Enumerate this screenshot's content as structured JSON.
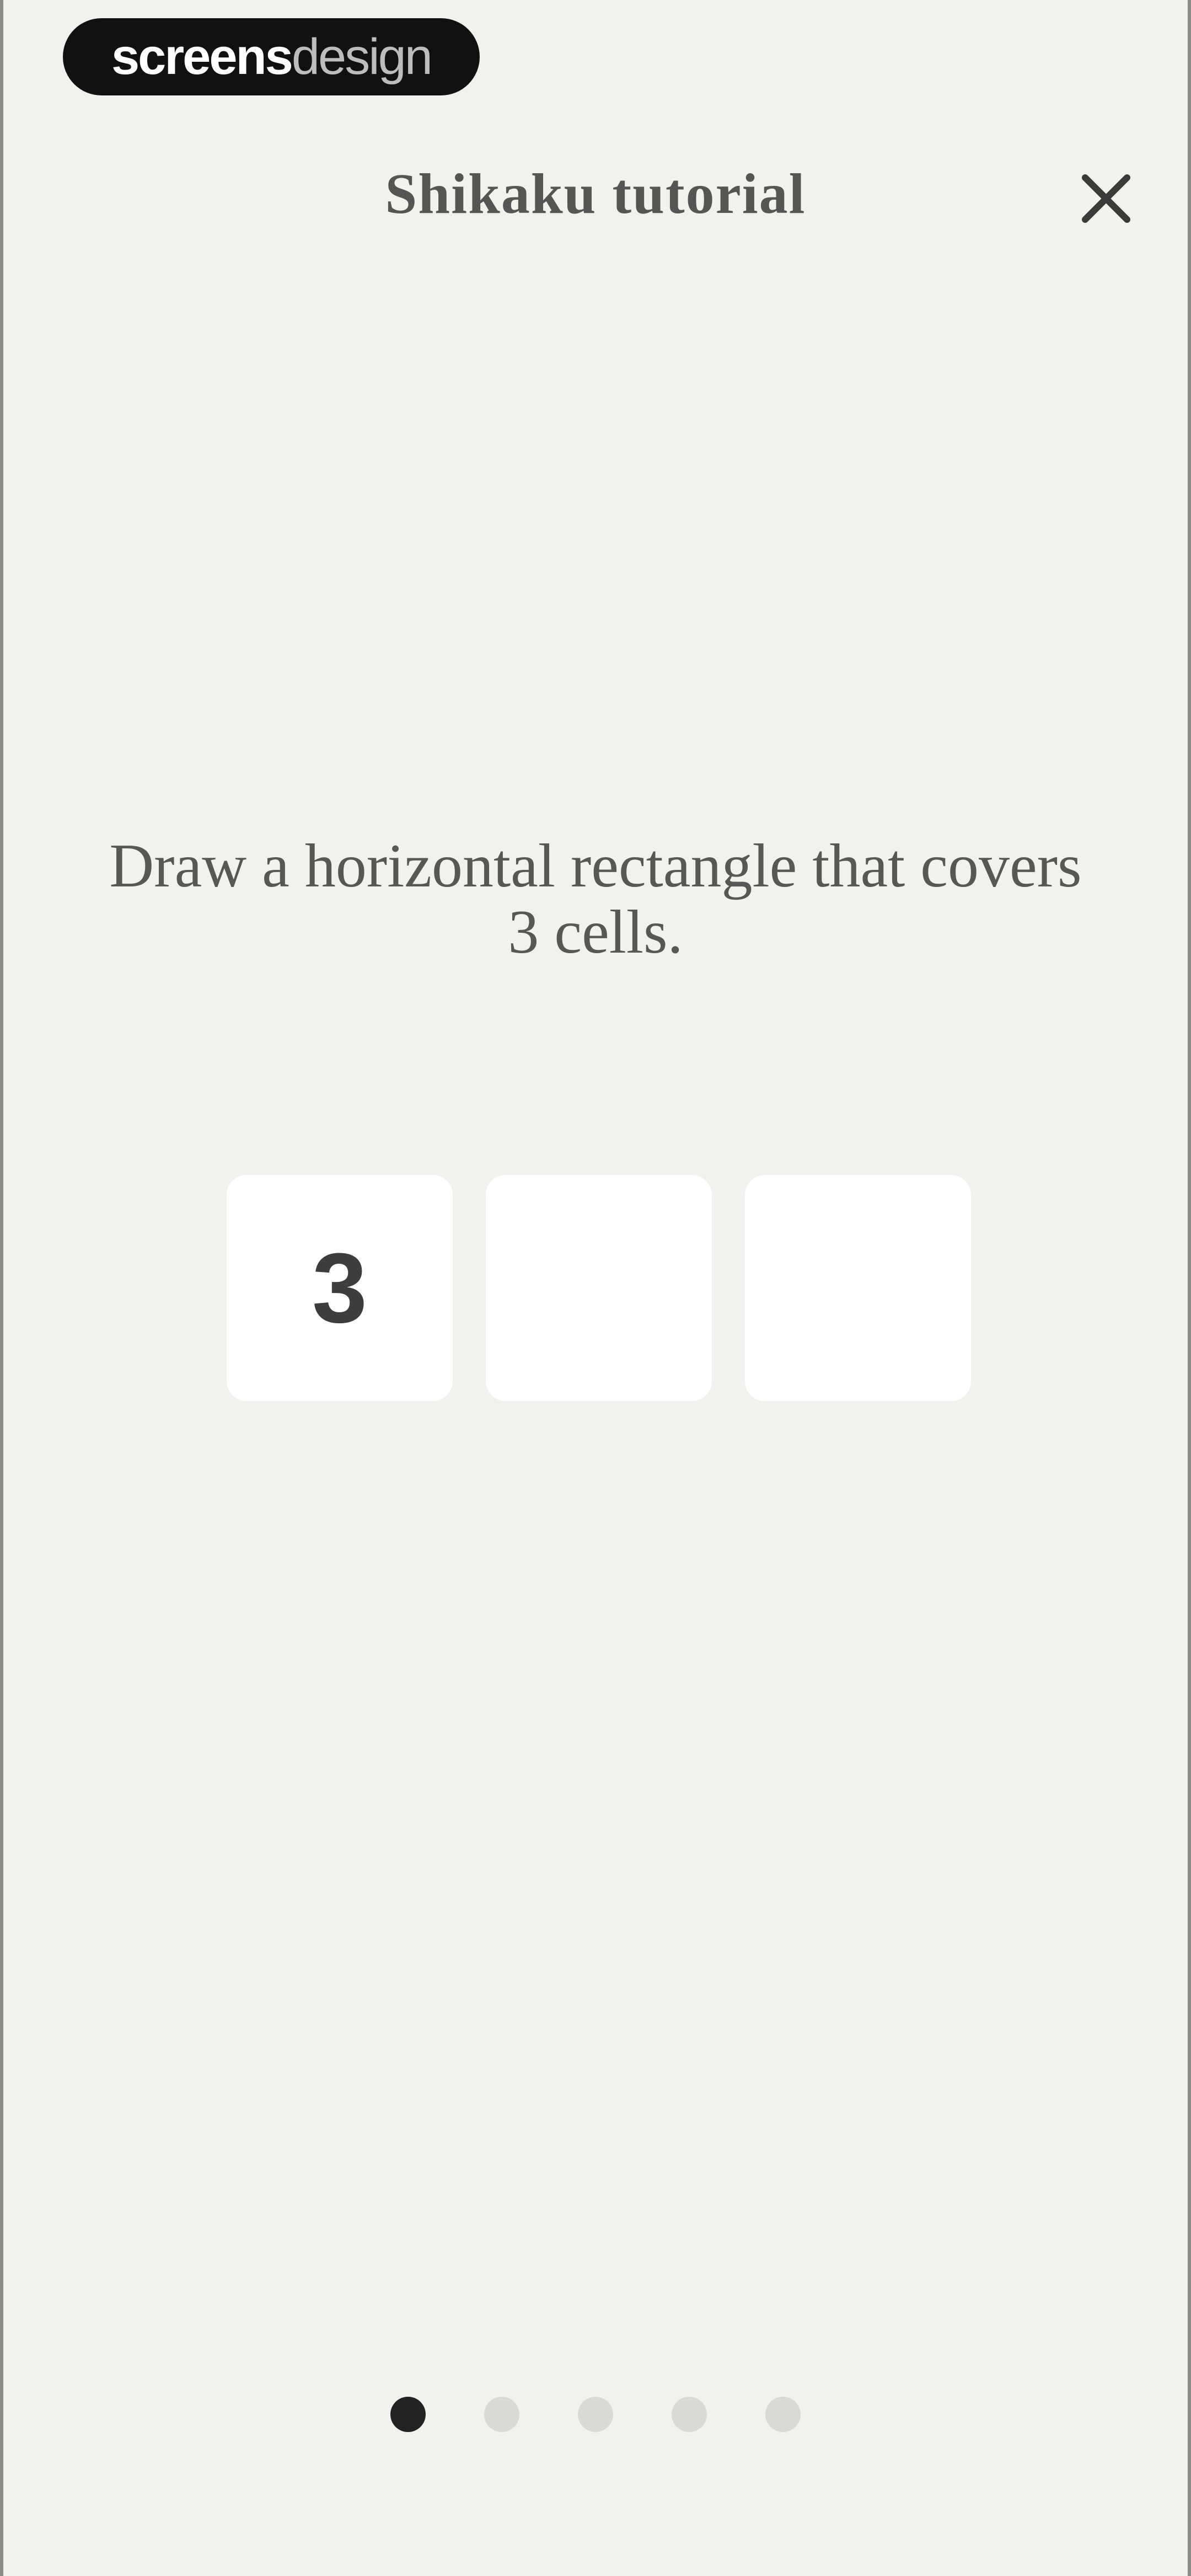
{
  "watermark": {
    "strong": "screens",
    "light": "design"
  },
  "header": {
    "title": "Shikaku tutorial",
    "close_icon": "close-icon"
  },
  "tutorial": {
    "instruction": "Draw a horizontal rectangle that covers 3 cells.",
    "cells": [
      "3",
      "",
      ""
    ]
  },
  "pager": {
    "total": 5,
    "active_index": 0
  },
  "colors": {
    "background": "#f3f1ee",
    "cell": "#ffffff",
    "active_dot": "#222222",
    "inactive_dot": "#dbd9d6"
  }
}
